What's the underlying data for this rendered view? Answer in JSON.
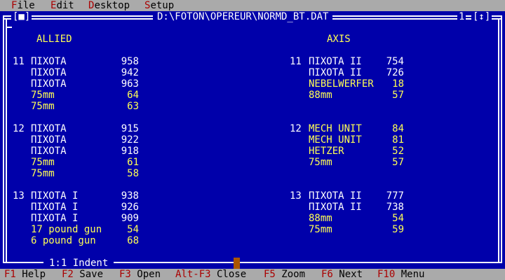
{
  "menu": [
    {
      "hot": "F",
      "rest": "ile"
    },
    {
      "hot": "E",
      "rest": "dit"
    },
    {
      "hot": "D",
      "rest": "esktop"
    },
    {
      "hot": "S",
      "rest": "etup"
    }
  ],
  "window": {
    "close_glyph": "[■]",
    "title": "D:\\FOTON\\OPEREUR\\NORMD_BT.DAT",
    "number": "1",
    "zoom_glyph": "[↕]",
    "status": "1:1 Indent"
  },
  "headers": {
    "allied": "ALLIED",
    "axis": "AXIS"
  },
  "allied": [
    {
      "num": "11",
      "rows": [
        {
          "name": "ПIХОТА",
          "value": "958"
        },
        {
          "name": "ПIХОТА",
          "value": "942"
        },
        {
          "name": "ПIХОТА",
          "value": "963"
        },
        {
          "name": "75mm",
          "value": "64"
        },
        {
          "name": "75mm",
          "value": "63"
        }
      ]
    },
    {
      "num": "12",
      "rows": [
        {
          "name": "ПIХОТА",
          "value": "915"
        },
        {
          "name": "ПIХОТА",
          "value": "922"
        },
        {
          "name": "ПIХОТА",
          "value": "918"
        },
        {
          "name": "75mm",
          "value": "61"
        },
        {
          "name": "75mm",
          "value": "58"
        }
      ]
    },
    {
      "num": "13",
      "rows": [
        {
          "name": "ПIХОТА I",
          "value": "938"
        },
        {
          "name": "ПIХОТА I",
          "value": "926"
        },
        {
          "name": "ПIХОТА I",
          "value": "909"
        },
        {
          "name": "17 pound gun",
          "value": "54"
        },
        {
          "name": "6 pound gun",
          "value": "68"
        }
      ]
    }
  ],
  "axis": [
    {
      "num": "11",
      "rows": [
        {
          "name": "ПIХОТА II",
          "value": "754"
        },
        {
          "name": "ПIХОТА II",
          "value": "726"
        },
        {
          "name": "NEBELWERFER",
          "value": "18"
        },
        {
          "name": "88mm",
          "value": "57"
        }
      ]
    },
    {
      "num": "12",
      "rows": [
        {
          "name": "MECH UNIT",
          "value": "84"
        },
        {
          "name": "MECH UNIT",
          "value": "81"
        },
        {
          "name": "HETZER",
          "value": "52"
        },
        {
          "name": "75mm",
          "value": "57"
        }
      ]
    },
    {
      "num": "13",
      "rows": [
        {
          "name": "ПIХОТА II",
          "value": "777"
        },
        {
          "name": "ПIХОТА II",
          "value": "738"
        },
        {
          "name": "88mm",
          "value": "54"
        },
        {
          "name": "75mm",
          "value": "59"
        }
      ]
    }
  ],
  "fkeys": [
    {
      "key": "F1",
      "label": "Help"
    },
    {
      "key": "F2",
      "label": "Save"
    },
    {
      "key": "F3",
      "label": "Open"
    },
    {
      "key": "Alt-F3",
      "label": "Close"
    },
    {
      "key": "F5",
      "label": "Zoom"
    },
    {
      "key": "F6",
      "label": "Next"
    },
    {
      "key": "F10",
      "label": "Menu"
    }
  ],
  "colors": {
    "background": "#0000aa",
    "menubar": "#aaaaaa",
    "hotkey": "#aa0000",
    "text_white": "#ffffff",
    "text_yellow": "#ffff55",
    "scroll_thumb": "#aa5500"
  }
}
